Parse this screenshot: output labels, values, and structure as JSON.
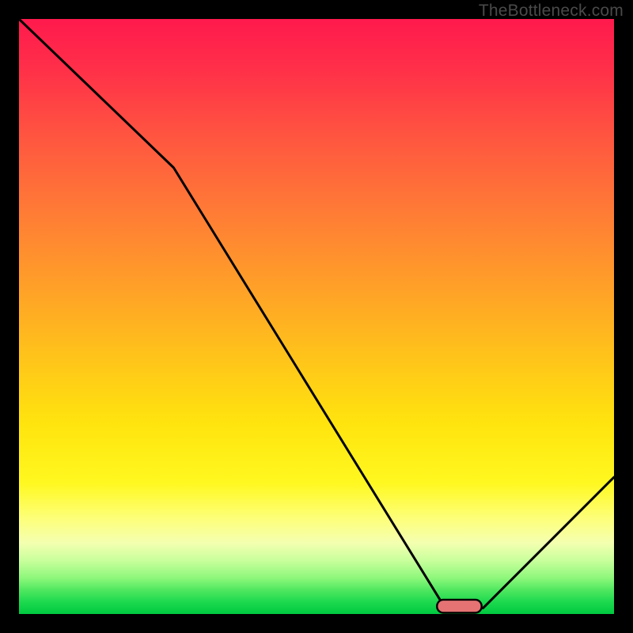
{
  "watermark": "TheBottleneck.com",
  "chart_data": {
    "type": "line",
    "title": "",
    "xlabel": "",
    "ylabel": "",
    "xlim": [
      0,
      100
    ],
    "ylim": [
      0,
      100
    ],
    "grid": false,
    "series": [
      {
        "name": "bottleneck-curve",
        "x": [
          0,
          26,
          71,
          78,
          100
        ],
        "y": [
          100,
          75,
          2,
          1,
          23
        ]
      }
    ],
    "marker": {
      "name": "optimal-range",
      "shape": "rounded-bar",
      "x_center": 74,
      "y_center": 1.3,
      "width_x_units": 7.5,
      "height_y_units": 2.2,
      "fill": "#e57373",
      "outline": "#000000"
    },
    "background": {
      "type": "vertical-gradient",
      "stops": [
        {
          "pos": 0.0,
          "color": "#ff1a4d"
        },
        {
          "pos": 0.45,
          "color": "#ffa028"
        },
        {
          "pos": 0.78,
          "color": "#fff820"
        },
        {
          "pos": 1.0,
          "color": "#00c940"
        }
      ]
    }
  }
}
